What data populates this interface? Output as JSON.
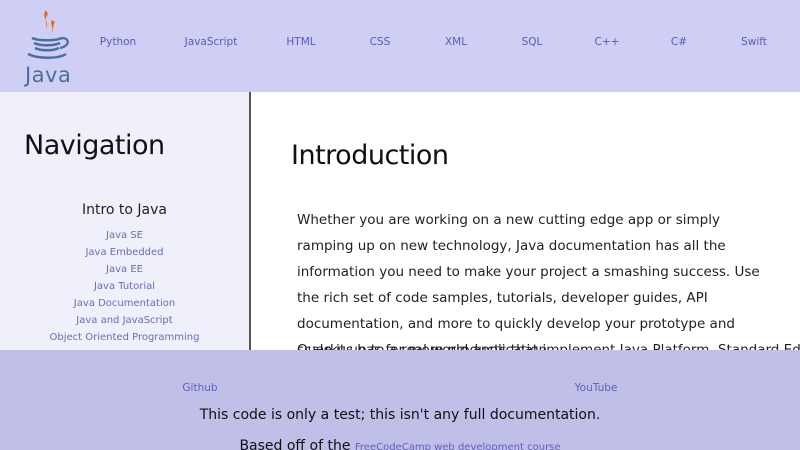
{
  "colors": {
    "topnav_bg": "#cfcff5",
    "sidebar_bg": "#f0f0fb",
    "footer_bg": "#bfbfe8",
    "link": "#6060c0",
    "java_orange": "#e76f00",
    "java_blue": "#4b6e9c"
  },
  "logo": {
    "icon": "java-coffee-cup-icon",
    "text": "Java"
  },
  "topnav": {
    "links": [
      "Python",
      "JavaScript",
      "HTML",
      "CSS",
      "XML",
      "SQL",
      "C++",
      "C#",
      "Swift"
    ]
  },
  "sidebar": {
    "heading": "Navigation",
    "group_title": "Intro to Java",
    "links": [
      "Java SE",
      "Java Embedded",
      "Java EE",
      "Java Tutorial",
      "Java Documentation",
      "Java and JavaScript",
      "Object Oriented Programming"
    ]
  },
  "main": {
    "heading": "Introduction",
    "paragraph": "Whether you are working on a new cutting edge app or simply ramping up on new technology, Java documentation has all the information you need to make your project a smashing success. Use the rich set of code samples, tutorials, developer guides, API documentation, and more to quickly develop your prototype and scale it up to a real world application.",
    "paragraph2": "Quarkus has for more products that implement Java Platform, Standard Edition"
  },
  "footer": {
    "links": [
      "Github",
      "YouTube"
    ],
    "note": "This code is only a test; this isn't any full documentation.",
    "credit_prefix": "Based off of the ",
    "credit_link": "FreeCodeCamp web development course"
  }
}
